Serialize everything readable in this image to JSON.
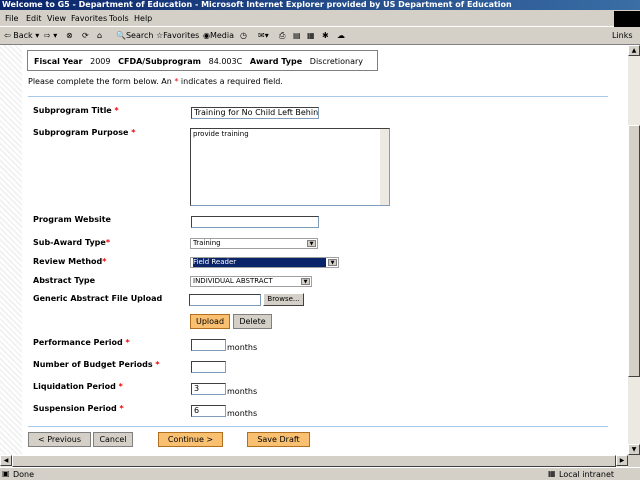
{
  "window": {
    "title": "Welcome to G5 - Department of Education - Microsoft Internet Explorer provided by US Department of Education"
  },
  "menu": [
    "File",
    "Edit",
    "View",
    "Favorites",
    "Tools",
    "Help"
  ],
  "toolbar": {
    "back": "Back",
    "search": "Search",
    "favorites": "Favorites",
    "media": "Media",
    "links": "Links"
  },
  "header": {
    "fiscal_year_label": "Fiscal Year",
    "fiscal_year": "2009",
    "cfda_label": "CFDA/Subprogram",
    "cfda": "84.003C",
    "award_type_label": "Award Type",
    "award_type": "Discretionary"
  },
  "instructions": {
    "before": "Please complete the form below. An ",
    "star": "*",
    "after": " indicates a required field."
  },
  "form": {
    "subprogram_title": {
      "label": "Subprogram Title",
      "value": "Training for No Child Left Behind"
    },
    "subprogram_purpose": {
      "label": "Subprogram Purpose",
      "value": "provide training"
    },
    "program_website": {
      "label": "Program Website",
      "value": ""
    },
    "sub_award_type": {
      "label": "Sub-Award Type",
      "value": "Training"
    },
    "review_method": {
      "label": "Review Method",
      "value": "Field Reader"
    },
    "abstract_type": {
      "label": "Abstract Type",
      "value": "INDIVIDUAL ABSTRACT"
    },
    "abstract_upload": {
      "label": "Generic Abstract File Upload",
      "value": "",
      "browse": "Browse...",
      "upload": "Upload",
      "delete": "Delete"
    },
    "performance_period": {
      "label": "Performance Period",
      "value": "",
      "unit": "months"
    },
    "budget_periods": {
      "label": "Number of Budget Periods",
      "value": ""
    },
    "liquidation_period": {
      "label": "Liquidation Period",
      "value": "3",
      "unit": "months"
    },
    "suspension_period": {
      "label": "Suspension Period",
      "value": "6",
      "unit": "months"
    },
    "req": "*"
  },
  "buttons": {
    "previous": "< Previous",
    "cancel": "Cancel",
    "continue": "Continue >",
    "save_draft": "Save Draft"
  },
  "status": {
    "text": "Done",
    "zone": "Local intranet"
  }
}
